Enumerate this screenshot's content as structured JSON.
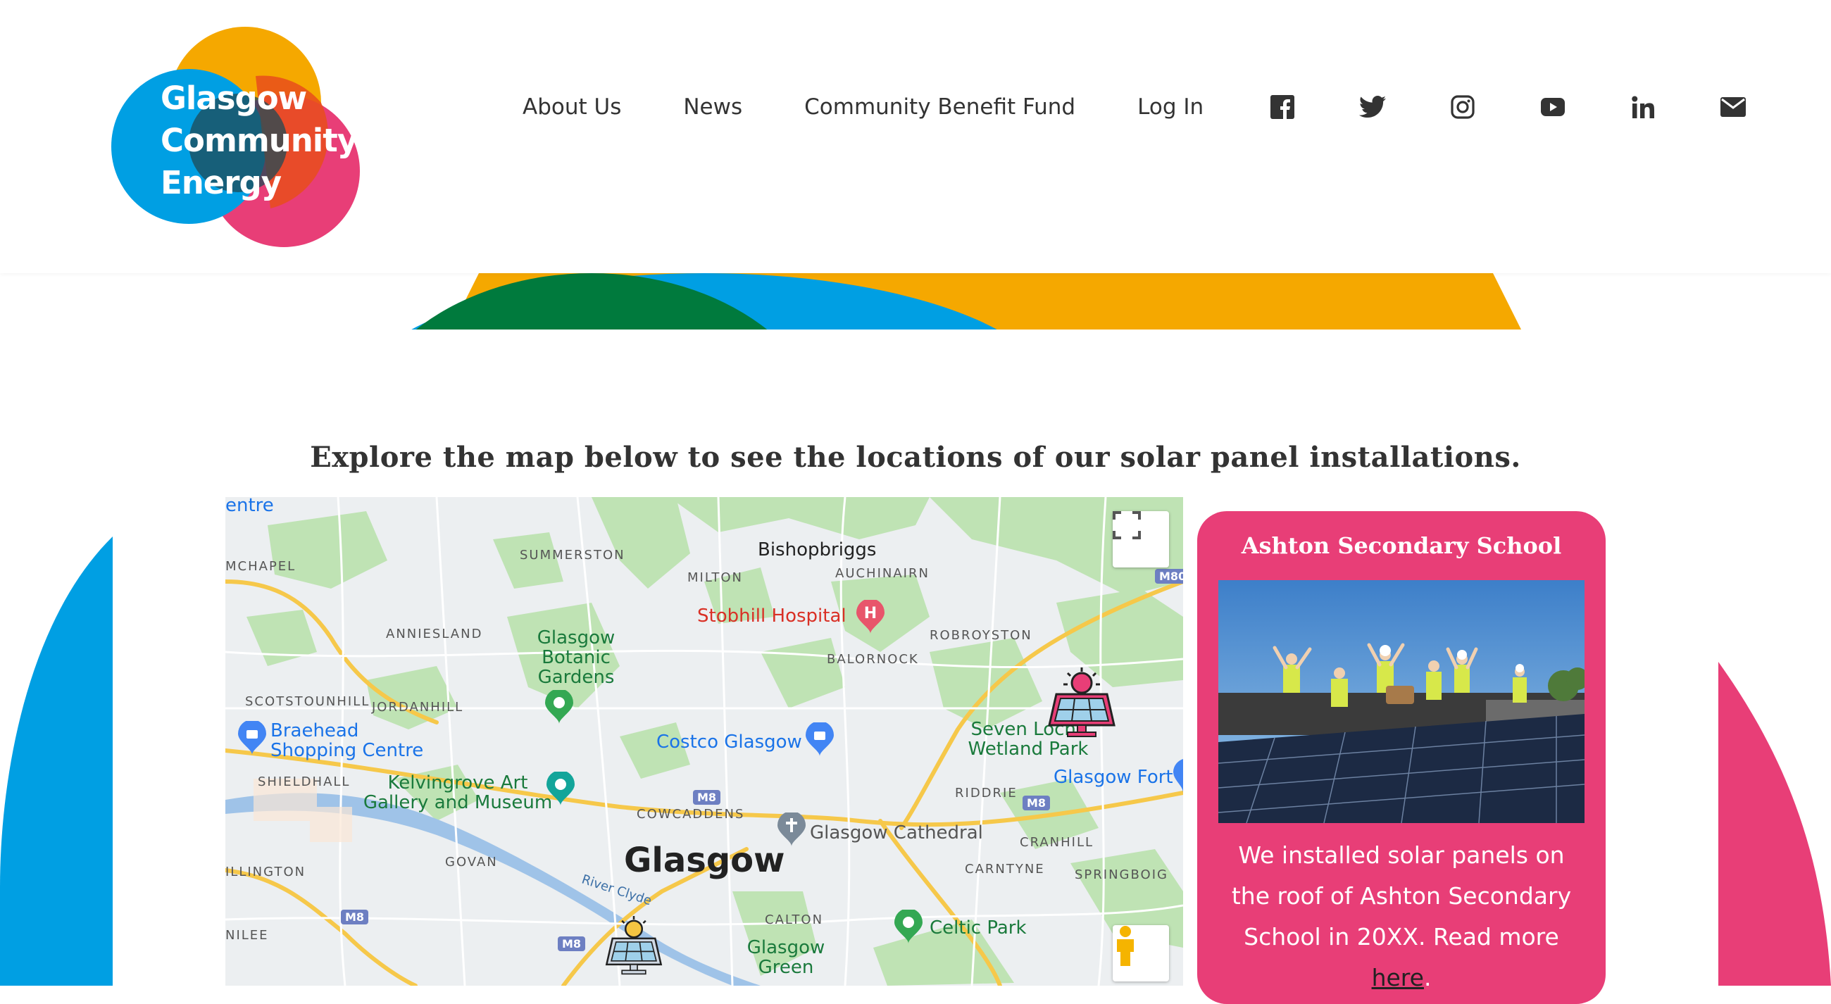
{
  "brand": {
    "logo_lines": [
      "Glasgow",
      "Community",
      "Energy"
    ],
    "colors": {
      "orange": "#f5a800",
      "blue": "#009fe3",
      "pink": "#e83e77",
      "green": "#007a3d",
      "red": "#e84e1b",
      "dark": "#333333"
    }
  },
  "nav": {
    "items": [
      {
        "label": "About Us"
      },
      {
        "label": "News"
      },
      {
        "label": "Community Benefit Fund"
      },
      {
        "label": "Log In"
      }
    ],
    "social": [
      "facebook-icon",
      "twitter-icon",
      "instagram-icon",
      "youtube-icon",
      "linkedin-icon",
      "email-icon"
    ]
  },
  "main": {
    "heading": "Explore the map below to see the locations of our solar panel installations."
  },
  "map": {
    "city": "Glasgow",
    "towns": [
      "Bishopbriggs"
    ],
    "districts": [
      "SUMMERSTON",
      "MILTON",
      "AUCHINAIRN",
      "ANNIESLAND",
      "BALORNOCK",
      "ROBROYSTON",
      "SCOTSTOUNHILL",
      "JORDANHILL",
      "SHIELDHALL",
      "COWCADDENS",
      "RIDDRIE",
      "CRANHILL",
      "CARNTYNE",
      "SPRINGBOIG",
      "GOVAN",
      "CALTON",
      "MCHAPEL",
      "ILLINGTON",
      "NILEE"
    ],
    "places": {
      "hospital": "Stobhill Hospital",
      "botanic": "Glasgow Botanic Gardens",
      "costco": "Costco Glasgow",
      "braehead": "Braehead Shopping Centre",
      "kelvingrove": "Kelvingrove Art Gallery and Museum",
      "cathedral": "Glasgow Cathedral",
      "celtic": "Celtic Park",
      "green": "Glasgow Green",
      "sevenlochs": "Seven Lochs Wetland Park",
      "fort": "Glasgow Fort",
      "centre": "entre",
      "river": "River Clyde"
    },
    "roads": [
      "M8",
      "M8",
      "M8",
      "M8",
      "M80"
    ]
  },
  "card": {
    "title": "Ashton Secondary School",
    "text_before": "We installed solar panels on the roof of Ashton Secondary School in 20XX. Read more ",
    "link": "here",
    "text_after": "."
  }
}
